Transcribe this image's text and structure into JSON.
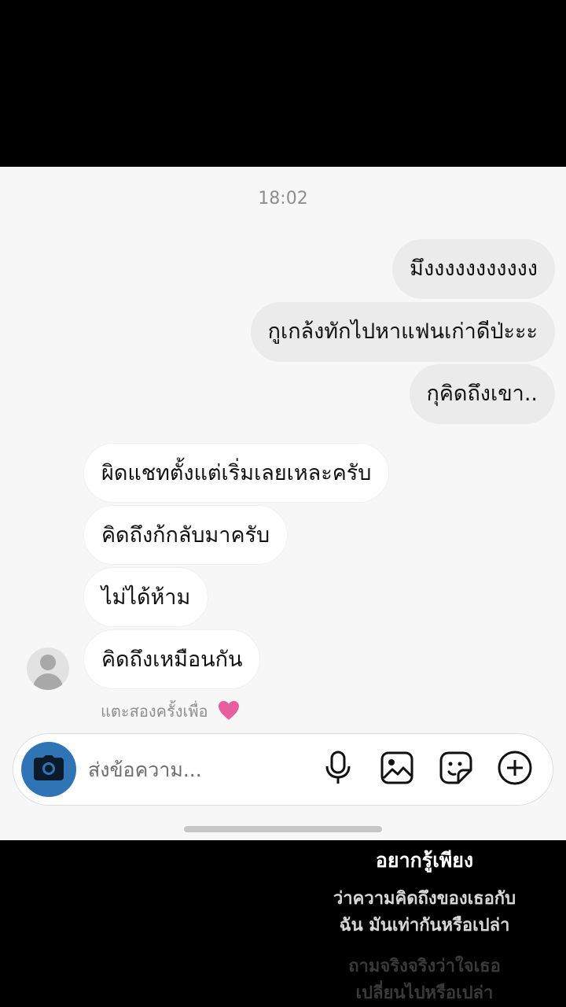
{
  "chat": {
    "timestamp": "18:02",
    "outgoing": [
      "มึงงงงงงงงงงง",
      "กูเกล้งทักไปหาแฟนเก่าดีป่ะะะ",
      "กุคิดถึงเขา.."
    ],
    "incoming": [
      "ผิดแชทตั้งแต่เริ่มเลยเหละครับ",
      "คิดถึงก้กลับมาครับ",
      "ไม่ได้ห้าม",
      "คิดถึงเหมือนกัน"
    ],
    "double_tap_hint": "แตะสองครั้งเพื่อ",
    "hint_heart_color": "#e85fa0"
  },
  "composer": {
    "placeholder": "ส่งข้อความ...",
    "camera_color": "#2f74b4",
    "icons": [
      "camera-icon",
      "microphone-icon",
      "gallery-icon",
      "sticker-icon",
      "add-icon"
    ]
  },
  "lyrics": {
    "line1": "อยากรู้เพียง",
    "line2a": "ว่าความคิดถึงของเธอกับ",
    "line2b": "ฉัน มันเท่ากันหรือเปล่า",
    "line3a": "ถามจริงจริงว่าใจเธอ",
    "line3b": "เปลี่ยนไปหรือเปล่า"
  }
}
